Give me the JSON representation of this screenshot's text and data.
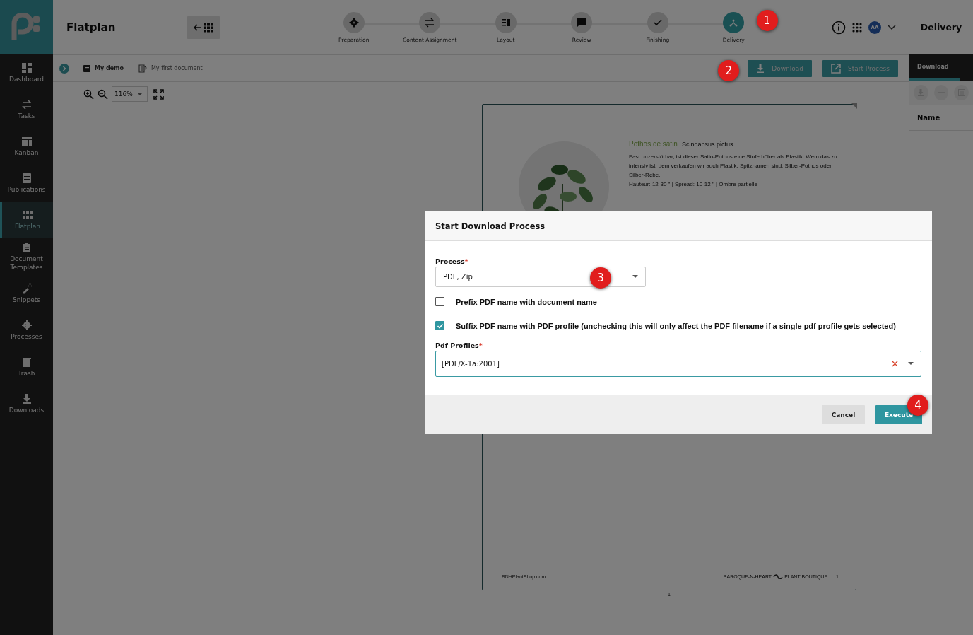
{
  "app": {
    "title": "Flatplan"
  },
  "sidebar": {
    "items": [
      {
        "label": "Dashboard",
        "selected": false
      },
      {
        "label": "Tasks",
        "selected": false
      },
      {
        "label": "Kanban",
        "selected": false
      },
      {
        "label": "Publications",
        "selected": false
      },
      {
        "label": "Flatplan",
        "selected": true
      },
      {
        "label": "Document Templates",
        "selected": false
      },
      {
        "label": "Snippets",
        "selected": false
      },
      {
        "label": "Processes",
        "selected": false
      },
      {
        "label": "Trash",
        "selected": false
      },
      {
        "label": "Downloads",
        "selected": false
      }
    ]
  },
  "steps": [
    {
      "label": "Preparation",
      "selected": false
    },
    {
      "label": "Content Assignment",
      "selected": false
    },
    {
      "label": "Layout",
      "selected": false
    },
    {
      "label": "Review",
      "selected": false
    },
    {
      "label": "Finishing",
      "selected": false
    },
    {
      "label": "Delivery",
      "selected": true,
      "callout": "1"
    }
  ],
  "user": {
    "initials": "AA"
  },
  "breadcrumb": [
    "My demo",
    "My first document"
  ],
  "toolbar": {
    "buttons": [
      {
        "label": "Download",
        "callout": "2"
      },
      {
        "label": "Start Process"
      }
    ]
  },
  "zoom": {
    "value": "116%"
  },
  "document": {
    "title": "Pothos de satin",
    "subtitle": "Scindapsus pictus",
    "body": "Fast unzerstörbar, ist dieser Satin-Pothos eine Stufe höher als Plastik. Wem das zu intensiv ist, dem verkaufen wir auch Plastik. Spitznamen sind: Silber-Pothos oder Silber-Rebe.",
    "specs": "Hauteur: 12-30 \" | Spread: 10-12 \" | Ombre partielle",
    "footer_left": "BNHPlantShop.com",
    "footer_brand": "BAROQUE-N-HEART",
    "footer_shop": "PLANT BOUTIQUE",
    "footer_page": "1",
    "page_number": "1"
  },
  "right_panel": {
    "title": "Delivery",
    "tabs": [
      {
        "label": "Download",
        "selected": true
      }
    ],
    "column": "Name"
  },
  "dialog": {
    "title": "Start Download Process",
    "process": {
      "label": "Process",
      "required_mark": "*",
      "value": "PDF, Zip",
      "callout": "3"
    },
    "options": [
      {
        "label": "Prefix PDF name with document name",
        "checked": false
      },
      {
        "label": "Suffix PDF name with PDF profile (unchecking this will only affect the PDF filename if a single pdf profile gets selected)",
        "checked": true
      }
    ],
    "profiles": {
      "label": "Pdf Profiles",
      "required_mark": "*",
      "value": "[PDF/X-1a:2001]"
    },
    "buttons": [
      {
        "label": "Cancel",
        "kind": "secondary"
      },
      {
        "label": "Execute",
        "kind": "primary",
        "callout": "4"
      }
    ]
  }
}
